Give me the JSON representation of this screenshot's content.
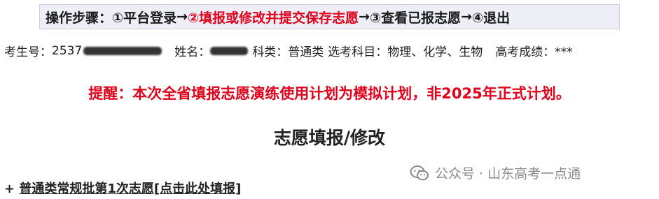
{
  "steps": {
    "label": "操作步骤：",
    "items": [
      {
        "text": "①平台登录",
        "active": false
      },
      {
        "text": "②填报或修改并提交保存志愿",
        "active": true
      },
      {
        "text": "③查看已报志愿",
        "active": false
      },
      {
        "text": "④退出",
        "active": false
      }
    ],
    "arrow": "→",
    "colors": {
      "active": "#e0001b",
      "normal": "#1a1a1a",
      "bar_bg": "#eeeef7"
    }
  },
  "info": {
    "exam_no_label": "考生号：",
    "exam_no_visible": "2537",
    "name_label": "姓名：",
    "category": "科类：普通类",
    "subjects": "选考科目：物理、化学、生物",
    "score": "高考成绩：***"
  },
  "reminder": "提醒：本次全省填报志愿演练使用计划为模拟计划，非2025年正式计划。",
  "section_title": "志愿填报/修改",
  "entry": {
    "prefix": "+ ",
    "title": "普通类常规批第1次志愿",
    "action": "[点击此处填报]"
  },
  "watermark": {
    "icon": "wechat-icon",
    "text": "公众号 · 山东高考一点通"
  }
}
